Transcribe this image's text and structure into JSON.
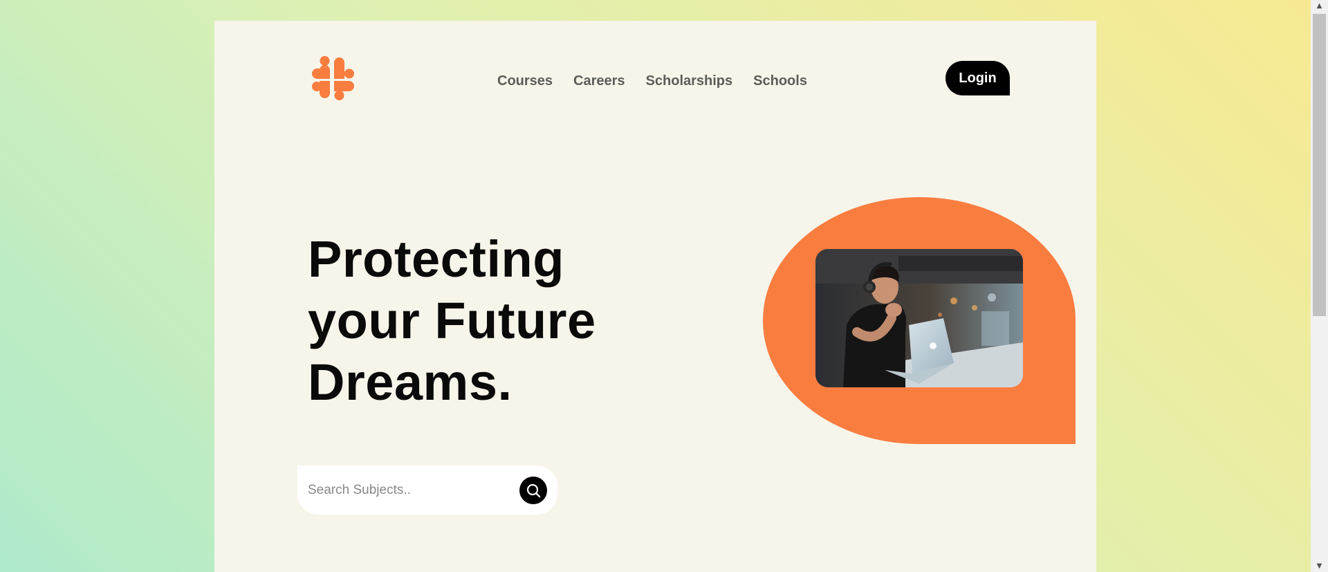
{
  "brand": {
    "logo_icon": "hashtag-logo-icon",
    "accent_color": "#fa7d40"
  },
  "nav": {
    "items": [
      {
        "label": "Courses"
      },
      {
        "label": "Careers"
      },
      {
        "label": "Scholarships"
      },
      {
        "label": "Schools"
      }
    ]
  },
  "header": {
    "login_label": "Login"
  },
  "hero": {
    "title_line1": "Protecting",
    "title_line2": "your Future",
    "title_line3": "Dreams.",
    "image_icon": "student-laptop-photo"
  },
  "search": {
    "placeholder": "Search Subjects..",
    "value": "",
    "icon": "search-icon"
  },
  "colors": {
    "card_background": "#f7f5ea",
    "button": "#000000",
    "text": "#0a0a0a",
    "nav_text": "#5c5c58"
  }
}
